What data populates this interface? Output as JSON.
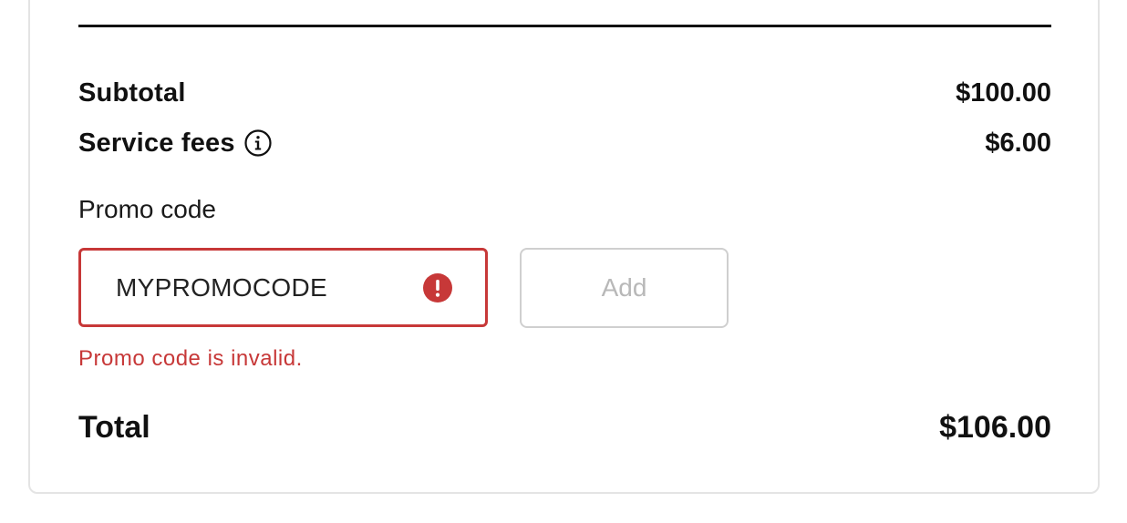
{
  "summary": {
    "subtotal_label": "Subtotal",
    "subtotal_amount": "$100.00",
    "service_fees_label": "Service fees",
    "service_fees_amount": "$6.00",
    "service_fees_info_icon": "info-circle-icon",
    "total_label": "Total",
    "total_amount": "$106.00"
  },
  "promo": {
    "label": "Promo code",
    "value": "MYPROMOCODE",
    "error_icon": "exclamation-circle-icon",
    "error_message": "Promo code is invalid.",
    "add_button_label": "Add"
  },
  "colors": {
    "error": "#c73838",
    "text": "#111111",
    "disabled_text": "#b8b8b8",
    "border": "#cfcfcf"
  }
}
